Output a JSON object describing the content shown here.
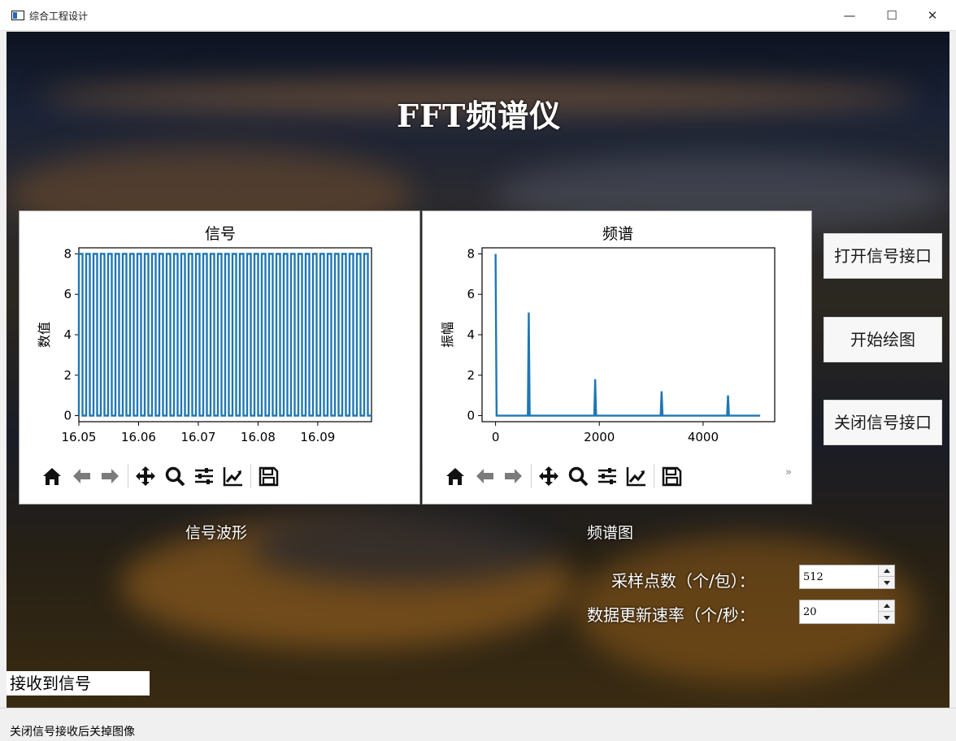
{
  "window": {
    "title": "综合工程设计",
    "controls": {
      "minimize": "—",
      "maximize": "☐",
      "close": "✕"
    }
  },
  "header": {
    "title": "FFT频谱仪"
  },
  "signal_plot": {
    "title": "信号",
    "ylabel": "数值",
    "caption": "信号波形"
  },
  "spectrum_plot": {
    "title": "频谱",
    "ylabel": "振幅",
    "caption": "频谱图",
    "overflow_label": "»"
  },
  "toolbar_icons": [
    "home-icon",
    "back-arrow-icon",
    "forward-arrow-icon",
    "pan-icon",
    "zoom-icon",
    "configure-subplots-icon",
    "edit-axes-icon",
    "save-icon"
  ],
  "buttons": {
    "open_port": "打开信号接口",
    "start_plot": "开始绘图",
    "close_port": "关闭信号接口"
  },
  "params": {
    "sample_points_label": "采样点数（个/包）：",
    "sample_points_value": "512",
    "update_rate_label": "数据更新速率（个/秒：",
    "update_rate_value": "20"
  },
  "received_label": "接收到信号",
  "status": {
    "text": "关闭信号接收后关掉图像"
  },
  "chart_data": [
    {
      "type": "line",
      "title": "信号",
      "xlabel": "",
      "ylabel": "数值",
      "xlim": [
        16.05,
        16.099
      ],
      "ylim": [
        -0.3,
        8.3
      ],
      "x_ticks": [
        "16.05",
        "16.06",
        "16.07",
        "16.08",
        "16.09"
      ],
      "y_ticks": [
        "0",
        "2",
        "4",
        "6",
        "8"
      ],
      "series": [
        {
          "shape": "square wave",
          "low": 0,
          "high": 8,
          "cycles": 40
        }
      ],
      "color": "#1f77b4",
      "grid": false
    },
    {
      "type": "line",
      "title": "频谱",
      "xlabel": "",
      "ylabel": "振幅",
      "xlim": [
        -260,
        5380
      ],
      "ylim": [
        -0.3,
        8.3
      ],
      "x_ticks": [
        "0",
        "2000",
        "4000"
      ],
      "y_ticks": [
        "0",
        "2",
        "4",
        "6",
        "8"
      ],
      "series": [
        {
          "x": [
            0,
            640,
            1920,
            3200,
            4480
          ],
          "y": [
            8.0,
            5.1,
            1.8,
            1.2,
            1.0
          ],
          "x_max": 5100
        }
      ],
      "color": "#1f77b4",
      "grid": false
    }
  ]
}
